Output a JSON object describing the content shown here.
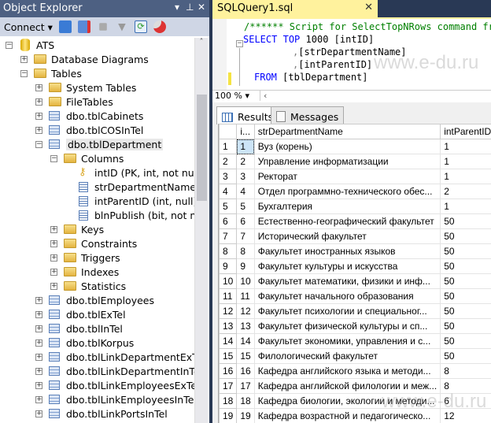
{
  "object_explorer": {
    "title": "Object Explorer",
    "controls": [
      "▾",
      "⊥",
      "✕"
    ],
    "connect_label": "Connect",
    "tree": [
      {
        "label": "ATS",
        "icon": "database",
        "level": 0,
        "state": "expanded"
      },
      {
        "label": "Database Diagrams",
        "icon": "folder",
        "level": 1,
        "state": "collapsed"
      },
      {
        "label": "Tables",
        "icon": "folder",
        "level": 1,
        "state": "expanded"
      },
      {
        "label": "System Tables",
        "icon": "folder",
        "level": 2,
        "state": "collapsed"
      },
      {
        "label": "FileTables",
        "icon": "folder",
        "level": 2,
        "state": "collapsed"
      },
      {
        "label": "dbo.tblCabinets",
        "icon": "table",
        "level": 2,
        "state": "collapsed"
      },
      {
        "label": "dbo.tblCOSInTel",
        "icon": "table",
        "level": 2,
        "state": "collapsed"
      },
      {
        "label": "dbo.tblDepartment",
        "icon": "table",
        "level": 2,
        "state": "expanded",
        "selected": true
      },
      {
        "label": "Columns",
        "icon": "folder",
        "level": 3,
        "state": "expanded"
      },
      {
        "label": "intID (PK, int, not null)",
        "icon": "key",
        "level": 4,
        "state": "leaf"
      },
      {
        "label": "strDepartmentName (nv",
        "icon": "column",
        "level": 4,
        "state": "leaf"
      },
      {
        "label": "intParentID (int, null)",
        "icon": "column",
        "level": 4,
        "state": "leaf"
      },
      {
        "label": "blnPublish (bit, not null)",
        "icon": "column",
        "level": 4,
        "state": "leaf"
      },
      {
        "label": "Keys",
        "icon": "folder",
        "level": 3,
        "state": "collapsed"
      },
      {
        "label": "Constraints",
        "icon": "folder",
        "level": 3,
        "state": "collapsed"
      },
      {
        "label": "Triggers",
        "icon": "folder",
        "level": 3,
        "state": "collapsed"
      },
      {
        "label": "Indexes",
        "icon": "folder",
        "level": 3,
        "state": "collapsed"
      },
      {
        "label": "Statistics",
        "icon": "folder",
        "level": 3,
        "state": "collapsed"
      },
      {
        "label": "dbo.tblEmployees",
        "icon": "table",
        "level": 2,
        "state": "collapsed"
      },
      {
        "label": "dbo.tblExTel",
        "icon": "table",
        "level": 2,
        "state": "collapsed"
      },
      {
        "label": "dbo.tblInTel",
        "icon": "table",
        "level": 2,
        "state": "collapsed"
      },
      {
        "label": "dbo.tblKorpus",
        "icon": "table",
        "level": 2,
        "state": "collapsed"
      },
      {
        "label": "dbo.tblLinkDepartmentExTel",
        "icon": "table",
        "level": 2,
        "state": "collapsed"
      },
      {
        "label": "dbo.tblLinkDepartmentInTel",
        "icon": "table",
        "level": 2,
        "state": "collapsed"
      },
      {
        "label": "dbo.tblLinkEmployeesExTel",
        "icon": "table",
        "level": 2,
        "state": "collapsed"
      },
      {
        "label": "dbo.tblLinkEmployeesInTel",
        "icon": "table",
        "level": 2,
        "state": "collapsed"
      },
      {
        "label": "dbo.tblLinkPortsInTel",
        "icon": "table",
        "level": 2,
        "state": "collapsed"
      }
    ]
  },
  "editor": {
    "tab_title": "SQLQuery1.sql",
    "close": "✕",
    "comment": "/****** Script for SelectTopNRows command fro",
    "kw_select": "SELECT",
    "kw_top": "TOP",
    "num": "1000",
    "col1": "[intID]",
    "col2": "[strDepartmentName]",
    "col3": "[intParentID]",
    "kw_from": "FROM",
    "table": "[tblDepartment]",
    "zoom": "100 %"
  },
  "results": {
    "tabs": [
      "Results",
      "Messages"
    ],
    "columns": [
      "i...",
      "strDepartmentName",
      "intParentID"
    ],
    "rows": [
      [
        "1",
        "1",
        "Вуз (корень)",
        "1"
      ],
      [
        "2",
        "2",
        "Управление информатизации",
        "1"
      ],
      [
        "3",
        "3",
        "Ректорат",
        "1"
      ],
      [
        "4",
        "4",
        "Отдел программно-технического обес...",
        "2"
      ],
      [
        "5",
        "5",
        "Бухгалтерия",
        "1"
      ],
      [
        "6",
        "6",
        "Естественно-географический факультет",
        "50"
      ],
      [
        "7",
        "7",
        "Исторический факультет",
        "50"
      ],
      [
        "8",
        "8",
        "Факультет иностранных языков",
        "50"
      ],
      [
        "9",
        "9",
        "Факультет культуры и искусства",
        "50"
      ],
      [
        "10",
        "10",
        "Факультет математики, физики и инф...",
        "50"
      ],
      [
        "11",
        "11",
        "Факультет начального образования",
        "50"
      ],
      [
        "12",
        "12",
        "Факультет психологии и специальног...",
        "50"
      ],
      [
        "13",
        "13",
        "Факультет физической культуры и сп...",
        "50"
      ],
      [
        "14",
        "14",
        "Факультет экономики, управления и с...",
        "50"
      ],
      [
        "15",
        "15",
        "Филологический факультет",
        "50"
      ],
      [
        "16",
        "16",
        "Кафедра английского языка и методи...",
        "8"
      ],
      [
        "17",
        "17",
        "Кафедра английской филологии и меж...",
        "8"
      ],
      [
        "18",
        "18",
        "Кафедра биологии, экологии и методи...",
        "6"
      ],
      [
        "19",
        "19",
        "Кафедра возрастной и педагогическо...",
        "12"
      ]
    ]
  },
  "watermark": "www.e-du.ru"
}
